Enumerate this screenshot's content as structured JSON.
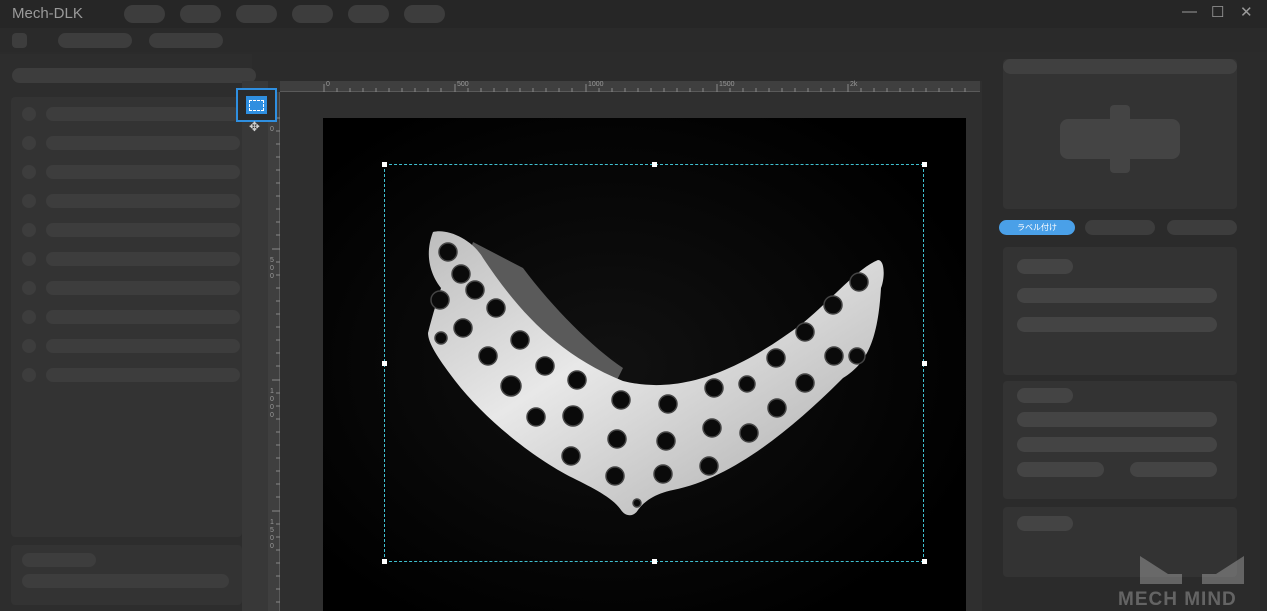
{
  "app": {
    "title": "Mech-DLK"
  },
  "window_controls": {
    "minimize": "—",
    "maximize": "☐",
    "close": "✕"
  },
  "canvas": {
    "ruler_top_labels": [
      "0",
      "500",
      "1000",
      "1500",
      "2k"
    ],
    "ruler_left_labels": [
      "0",
      "5\n0\n0",
      "1\n0\n0\n0",
      "1\n5\n0\n0"
    ],
    "tools": {
      "rect_icon": "rectangle-select-icon",
      "move_icon": "move-icon"
    }
  },
  "right_panel": {
    "tabs": [
      {
        "label": "ラベル付け",
        "active": true
      },
      {
        "label": ""
      },
      {
        "label": ""
      }
    ]
  },
  "watermark": {
    "text": "MECH MIND"
  },
  "colors": {
    "accent": "#2f8fe0",
    "tab_active": "#4aa0e8",
    "bbox": "#3fc0d0"
  }
}
